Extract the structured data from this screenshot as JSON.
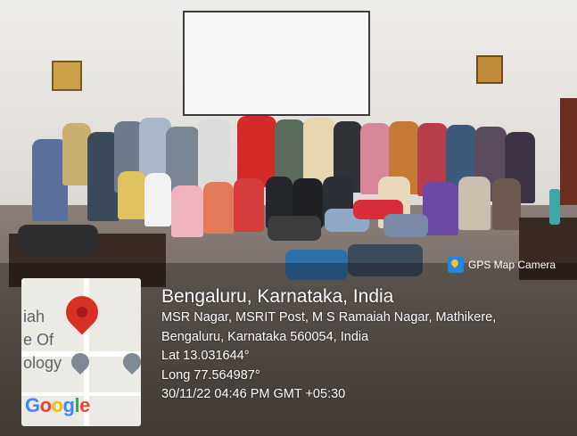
{
  "badge": {
    "label": "GPS Map Camera",
    "icon": "gps-map-camera-logo-icon"
  },
  "map": {
    "labels": [
      "iah",
      "e Of",
      "ology"
    ],
    "logo": [
      "G",
      "o",
      "o",
      "g",
      "l",
      "e"
    ],
    "pin_icon": "map-pin-icon",
    "poi_icon": "education-pin-icon"
  },
  "location": {
    "title": "Bengaluru, Karnataka, India",
    "address_line1": "MSR Nagar, MSRIT Post, M S Ramaiah Nagar, Mathikere,",
    "address_line2": "Bengaluru, Karnataka 560054, India",
    "latitude": "Lat 13.031644°",
    "longitude": "Long 77.564987°",
    "timestamp": "30/11/22 04:46 PM GMT +05:30"
  },
  "colors": {
    "pin": "#d93025",
    "badge_logo": "#1e88e5",
    "text": "#ffffff"
  }
}
